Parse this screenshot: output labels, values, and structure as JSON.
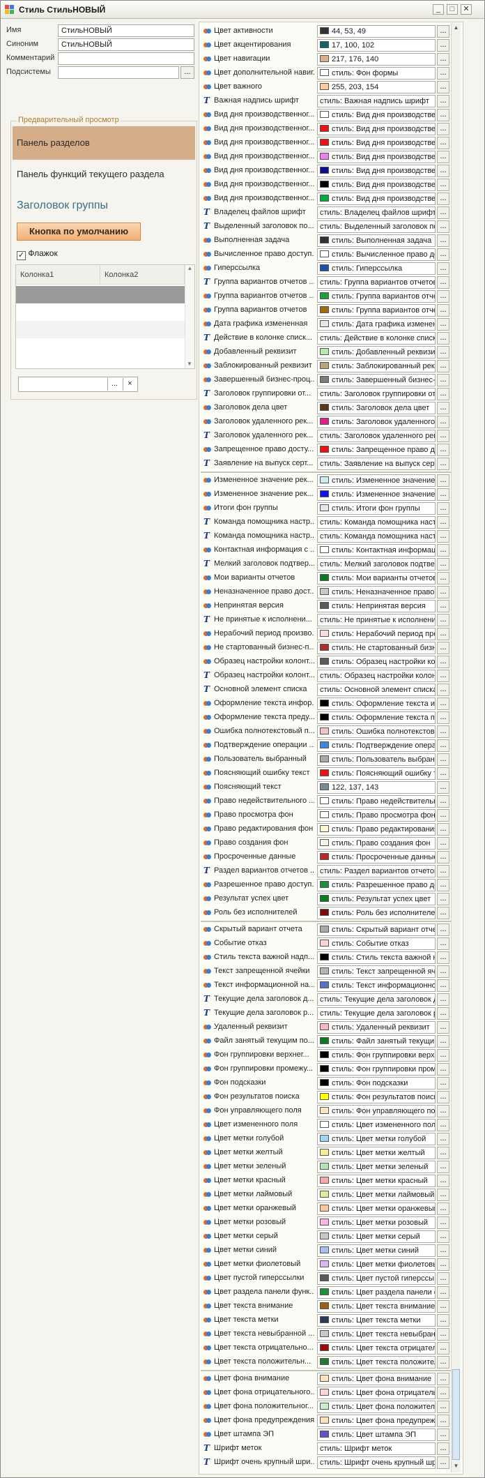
{
  "window": {
    "title": "Стиль СтильНОВЫЙ",
    "min": "_",
    "max": "□",
    "close": "✕"
  },
  "fields": {
    "name_label": "Имя",
    "name_value": "СтильНОВЫЙ",
    "synonym_label": "Синоним",
    "synonym_value": "СтильНОВЫЙ",
    "comment_label": "Комментарий",
    "comment_value": "",
    "subsystems_label": "Подсистемы",
    "subsystems_value": "",
    "browse_btn": "..."
  },
  "preview": {
    "legend": "Предварительный просмотр",
    "panel_sections": "Панель разделов",
    "panel_functions": "Панель функций текущего раздела",
    "group_title": "Заголовок группы",
    "default_button": "Кнопка по умолчанию",
    "flag_label": "Флажок",
    "flag_checked": true,
    "table_columns": [
      "Колонка1",
      "Колонка2"
    ],
    "combo_btn": "...",
    "combo_clear": "×"
  },
  "colors": {
    "accent_orange": "#f2b07a",
    "panel_bg": "#d5ad89",
    "selected_row": "#9a9a9a"
  },
  "style_rows": [
    {
      "name": "Цвет активности",
      "value": "44, 53, 49",
      "color": "#2c3531",
      "icon": "color-icon"
    },
    {
      "name": "Цвет акцентирования",
      "value": "17, 100, 102",
      "color": "#116466",
      "icon": "color-icon"
    },
    {
      "name": "Цвет навигации",
      "value": "217, 176, 140",
      "color": "#d9b08c",
      "icon": "color-icon"
    },
    {
      "name": "Цвет дополнительной навиг...",
      "value": "стиль: Фон формы",
      "color": "#ffffff",
      "icon": "color-icon"
    },
    {
      "name": "Цвет важного",
      "value": "255, 203, 154",
      "color": "#ffcb9a",
      "icon": "color-icon"
    },
    {
      "name": "Важная надпись шрифт",
      "value": "стиль: Важная надпись шрифт",
      "color": "",
      "icon": "font-icon"
    },
    {
      "name": "Вид дня производственног...",
      "value": "стиль: Вид дня производственн...",
      "color": "#ffffff",
      "icon": "color-icon"
    },
    {
      "name": "Вид дня производственног...",
      "value": "стиль: Вид дня производственн...",
      "color": "#e81515",
      "icon": "color-icon"
    },
    {
      "name": "Вид дня производственног...",
      "value": "стиль: Вид дня производственн...",
      "color": "#e81515",
      "icon": "color-icon"
    },
    {
      "name": "Вид дня производственног...",
      "value": "стиль: Вид дня производственн...",
      "color": "#ef7fe6",
      "icon": "color-icon"
    },
    {
      "name": "Вид дня производственног...",
      "value": "стиль: Вид дня производственн...",
      "color": "#0d0d8c",
      "icon": "color-icon"
    },
    {
      "name": "Вид дня производственног...",
      "value": "стиль: Вид дня производственн...",
      "color": "#000000",
      "icon": "color-icon"
    },
    {
      "name": "Вид дня производственног...",
      "value": "стиль: Вид дня производственн...",
      "color": "#00aa3c",
      "icon": "color-icon"
    },
    {
      "name": "Владелец файлов шрифт",
      "value": "стиль: Владелец файлов шрифт",
      "color": "",
      "icon": "font-icon"
    },
    {
      "name": "Выделенный заголовок по...",
      "value": "стиль: Выделенный заголовок по...",
      "color": "",
      "icon": "font-icon"
    },
    {
      "name": "Выполненная задача",
      "value": "стиль: Выполненная задача",
      "color": "#2c3531",
      "icon": "color-icon"
    },
    {
      "name": "Вычисленное право доступ...",
      "value": "стиль: Вычисленное право дос...",
      "color": "#ffffff",
      "icon": "color-icon"
    },
    {
      "name": "Гиперссылка",
      "value": "стиль: Гиперссылка",
      "color": "#1f4fa8",
      "icon": "color-icon"
    },
    {
      "name": "Группа вариантов отчетов ...",
      "value": "стиль: Группа вариантов отчетов ...",
      "color": "",
      "icon": "font-icon"
    },
    {
      "name": "Группа вариантов отчетов ...",
      "value": "стиль: Группа вариантов отче...",
      "color": "#1e9e3c",
      "icon": "color-icon"
    },
    {
      "name": "Группа вариантов отчетов",
      "value": "стиль: Группа вариантов отче...",
      "color": "#a36a12",
      "icon": "color-icon"
    },
    {
      "name": "Дата графика измененная",
      "value": "стиль: Дата графика изменен...",
      "color": "#e6e6e6",
      "icon": "color-icon"
    },
    {
      "name": "Действие в колонке списк...",
      "value": "стиль: Действие в колонке списк...",
      "color": "",
      "icon": "font-icon"
    },
    {
      "name": "Добавленный реквизит",
      "value": "стиль: Добавленный реквизит",
      "color": "#b7e8b0",
      "icon": "color-icon"
    },
    {
      "name": "Заблокированный реквизит",
      "value": "стиль: Заблокированный рекв...",
      "color": "#b5a67a",
      "icon": "color-icon"
    },
    {
      "name": "Завершенный бизнес-проц...",
      "value": "стиль: Завершенный бизнес-пр...",
      "color": "#7d7d7d",
      "icon": "color-icon"
    },
    {
      "name": "Заголовок группировки от...",
      "value": "стиль: Заголовок группировки от...",
      "color": "",
      "icon": "font-icon"
    },
    {
      "name": "Заголовок дела цвет",
      "value": "стиль: Заголовок дела цвет",
      "color": "#5a3b16",
      "icon": "color-icon"
    },
    {
      "name": "Заголовок удаленного рек...",
      "value": "стиль: Заголовок удаленного ...",
      "color": "#d8238a",
      "icon": "color-icon"
    },
    {
      "name": "Заголовок удаленного рек...",
      "value": "стиль: Заголовок удаленного рек...",
      "color": "",
      "icon": "font-icon"
    },
    {
      "name": "Запрещенное право досту...",
      "value": "стиль: Запрещенное право до...",
      "color": "#e81515",
      "icon": "color-icon"
    },
    {
      "name": "Заявление на выпуск серт...",
      "value": "стиль: Заявление на выпуск серт...",
      "color": "",
      "icon": "font-icon"
    },
    {
      "name": "Измененное значение рек...",
      "value": "стиль: Измененное значение ...",
      "color": "#cdeaf5",
      "icon": "color-icon"
    },
    {
      "name": "Измененное значение рек...",
      "value": "стиль: Измененное значение ...",
      "color": "#1414e0",
      "icon": "color-icon"
    },
    {
      "name": "Итоги фон группы",
      "value": "стиль: Итоги фон группы",
      "color": "#e6e6e6",
      "icon": "color-icon"
    },
    {
      "name": "Команда помощника настр...",
      "value": "стиль: Команда помощника настр...",
      "color": "",
      "icon": "font-icon"
    },
    {
      "name": "Команда помощника настр...",
      "value": "стиль: Команда помощника настр...",
      "color": "",
      "icon": "font-icon"
    },
    {
      "name": "Контактная информация с ...",
      "value": "стиль: Контактная информаци...",
      "color": "#ffffff",
      "icon": "color-icon"
    },
    {
      "name": "Мелкий заголовок подтвер...",
      "value": "стиль: Мелкий заголовок подтвер...",
      "color": "",
      "icon": "font-icon"
    },
    {
      "name": "Мои варианты отчетов",
      "value": "стиль: Мои варианты отчетов",
      "color": "#0b7a1e",
      "icon": "color-icon"
    },
    {
      "name": "Неназначенное право дост...",
      "value": "стиль: Неназначенное право д...",
      "color": "#c8c8c8",
      "icon": "color-icon"
    },
    {
      "name": "Непринятая версия",
      "value": "стиль: Непринятая версия",
      "color": "#5a5a5a",
      "icon": "color-icon"
    },
    {
      "name": "Не принятые к исполнени...",
      "value": "стиль: Не принятые к исполнени...",
      "color": "",
      "icon": "font-icon"
    },
    {
      "name": "Нерабочий период произво...",
      "value": "стиль: Нерабочий период прои...",
      "color": "#f7dede",
      "icon": "color-icon"
    },
    {
      "name": "Не стартованный бизнес-п...",
      "value": "стиль: Не стартованный бизне...",
      "color": "#b62a2a",
      "icon": "color-icon"
    },
    {
      "name": "Образец настройки колонт...",
      "value": "стиль: Образец настройки кол...",
      "color": "#5a5a5a",
      "icon": "color-icon"
    },
    {
      "name": "Образец настройки колонт...",
      "value": "стиль: Образец настройки колонт...",
      "color": "",
      "icon": "font-icon"
    },
    {
      "name": "Основной элемент списка",
      "value": "стиль: Основной элемент списка",
      "color": "",
      "icon": "font-icon"
    },
    {
      "name": "Оформление текста инфор...",
      "value": "стиль: Оформление текста ин...",
      "color": "#000000",
      "icon": "color-icon"
    },
    {
      "name": "Оформление текста преду...",
      "value": "стиль: Оформление текста пр...",
      "color": "#000000",
      "icon": "color-icon"
    },
    {
      "name": "Ошибка полнотекстовый п...",
      "value": "стиль: Ошибка полнотекстово...",
      "color": "#f4c3c3",
      "icon": "color-icon"
    },
    {
      "name": "Подтверждение операции ...",
      "value": "стиль: Подтверждение операц...",
      "color": "#3a8ad6",
      "icon": "color-icon"
    },
    {
      "name": "Пользователь выбранный",
      "value": "стиль: Пользователь выбранн...",
      "color": "#a9a9a9",
      "icon": "color-icon"
    },
    {
      "name": "Поясняющий ошибку текст",
      "value": "стиль: Поясняющий ошибку те...",
      "color": "#e81515",
      "icon": "color-icon"
    },
    {
      "name": "Поясняющий текст",
      "value": "122, 137, 143",
      "color": "#7a898f",
      "icon": "color-icon"
    },
    {
      "name": "Право недействительного ...",
      "value": "стиль: Право недействительн...",
      "color": "#ffffff",
      "icon": "color-icon"
    },
    {
      "name": "Право просмотра фон",
      "value": "стиль: Право просмотра фон",
      "color": "#ffffff",
      "icon": "color-icon"
    },
    {
      "name": "Право редактирования фон",
      "value": "стиль: Право редактирования ...",
      "color": "#fff6d5",
      "icon": "color-icon"
    },
    {
      "name": "Право создания фон",
      "value": "стиль: Право создания фон",
      "color": "#eef6e8",
      "icon": "color-icon"
    },
    {
      "name": "Просроченные данные",
      "value": "стиль: Просроченные данные",
      "color": "#b62a2a",
      "icon": "color-icon"
    },
    {
      "name": "Раздел вариантов отчетов ...",
      "value": "стиль: Раздел вариантов отчетов ...",
      "color": "",
      "icon": "font-icon"
    },
    {
      "name": "Разрешенное право доступ...",
      "value": "стиль: Разрешенное право до...",
      "color": "#1e8e3c",
      "icon": "color-icon"
    },
    {
      "name": "Результат успех цвет",
      "value": "стиль: Результат успех цвет",
      "color": "#0b7a1e",
      "icon": "color-icon"
    },
    {
      "name": "Роль без исполнителей",
      "value": "стиль: Роль без исполнителей",
      "color": "#7a0c0c",
      "icon": "color-icon"
    },
    {
      "name": "Скрытый вариант отчета",
      "value": "стиль: Скрытый вариант отчет...",
      "color": "#a9a9a9",
      "icon": "color-icon"
    },
    {
      "name": "Событие отказ",
      "value": "стиль: Событие отказ",
      "color": "#fad6d6",
      "icon": "color-icon"
    },
    {
      "name": "Стиль текста важной надп...",
      "value": "стиль: Стиль текста важной н...",
      "color": "#000000",
      "icon": "color-icon"
    },
    {
      "name": "Текст запрещенной ячейки",
      "value": "стиль: Текст запрещенной яче...",
      "color": "#b4b4b4",
      "icon": "color-icon"
    },
    {
      "name": "Текст информационной на...",
      "value": "стиль: Текст информационно...",
      "color": "#5a6fc8",
      "icon": "color-icon"
    },
    {
      "name": "Текущие дела заголовок д...",
      "value": "стиль: Текущие дела заголовок д...",
      "color": "",
      "icon": "font-icon"
    },
    {
      "name": "Текущие дела заголовок р...",
      "value": "стиль: Текущие дела заголовок р...",
      "color": "",
      "icon": "font-icon"
    },
    {
      "name": "Удаленный реквизит",
      "value": "стиль: Удаленный реквизит",
      "color": "#f4b8b8",
      "icon": "color-icon"
    },
    {
      "name": "Файл занятый текущим по...",
      "value": "стиль: Файл занятый текущи...",
      "color": "#0b7a1e",
      "icon": "color-icon"
    },
    {
      "name": "Фон группировки верхнег...",
      "value": "стиль: Фон группировки верх...",
      "color": "#000000",
      "icon": "color-icon"
    },
    {
      "name": "Фон группировки промежу...",
      "value": "стиль: Фон группировки пром...",
      "color": "#000000",
      "icon": "color-icon"
    },
    {
      "name": "Фон подсказки",
      "value": "стиль: Фон подсказки",
      "color": "#000000",
      "icon": "color-icon"
    },
    {
      "name": "Фон результатов поиска",
      "value": "стиль: Фон результатов поиск...",
      "color": "#ffff00",
      "icon": "color-icon"
    },
    {
      "name": "Фон управляющего поля",
      "value": "стиль: Фон управляющего по...",
      "color": "#fbe3c8",
      "icon": "color-icon"
    },
    {
      "name": "Цвет измененного поля",
      "value": "стиль: Цвет измененного пол...",
      "color": "#ffffff",
      "icon": "color-icon"
    },
    {
      "name": "Цвет метки голубой",
      "value": "стиль: Цвет метки голубой",
      "color": "#9fd5f0",
      "icon": "color-icon"
    },
    {
      "name": "Цвет метки желтый",
      "value": "стиль: Цвет метки желтый",
      "color": "#f3ef96",
      "icon": "color-icon"
    },
    {
      "name": "Цвет метки зеленый",
      "value": "стиль: Цвет метки зеленый",
      "color": "#b6e3b6",
      "icon": "color-icon"
    },
    {
      "name": "Цвет метки красный",
      "value": "стиль: Цвет метки красный",
      "color": "#f4aaaa",
      "icon": "color-icon"
    },
    {
      "name": "Цвет метки лаймовый",
      "value": "стиль: Цвет метки лаймовый",
      "color": "#d6ef9e",
      "icon": "color-icon"
    },
    {
      "name": "Цвет метки оранжевый",
      "value": "стиль: Цвет метки оранжевый",
      "color": "#f8c89a",
      "icon": "color-icon"
    },
    {
      "name": "Цвет метки розовый",
      "value": "стиль: Цвет метки розовый",
      "color": "#f7b7df",
      "icon": "color-icon"
    },
    {
      "name": "Цвет метки серый",
      "value": "стиль: Цвет метки серый",
      "color": "#c8c8c8",
      "icon": "color-icon"
    },
    {
      "name": "Цвет метки синий",
      "value": "стиль: Цвет метки синий",
      "color": "#a8bff0",
      "icon": "color-icon"
    },
    {
      "name": "Цвет метки фиолетовый",
      "value": "стиль: Цвет метки фиолетовый",
      "color": "#d8b8ef",
      "icon": "color-icon"
    },
    {
      "name": "Цвет пустой гиперссылки",
      "value": "стиль: Цвет пустой гиперссы...",
      "color": "#5a5a5a",
      "icon": "color-icon"
    },
    {
      "name": "Цвет раздела панели функ...",
      "value": "стиль: Цвет раздела панели ф...",
      "color": "#1e8e3c",
      "icon": "color-icon"
    },
    {
      "name": "Цвет текста внимание",
      "value": "стиль: Цвет текста внимание",
      "color": "#a35a12",
      "icon": "color-icon"
    },
    {
      "name": "Цвет текста метки",
      "value": "стиль: Цвет текста метки",
      "color": "#2c3a55",
      "icon": "color-icon"
    },
    {
      "name": "Цвет текста невыбранной ...",
      "value": "стиль: Цвет текста невыбран...",
      "color": "#c8c8c8",
      "icon": "color-icon"
    },
    {
      "name": "Цвет текста отрицательно...",
      "value": "стиль: Цвет текста отрицател...",
      "color": "#9a0c0c",
      "icon": "color-icon"
    },
    {
      "name": "Цвет текста положительн...",
      "value": "стиль: Цвет текста положител...",
      "color": "#1e7a2e",
      "icon": "color-icon"
    },
    {
      "name": "Цвет фона внимание",
      "value": "стиль: Цвет фона внимание",
      "color": "#fde4b8",
      "icon": "color-icon"
    },
    {
      "name": "Цвет фона отрицательного...",
      "value": "стиль: Цвет фона отрицатель...",
      "color": "#fad6d6",
      "icon": "color-icon"
    },
    {
      "name": "Цвет фона положительног...",
      "value": "стиль: Цвет фона положитель...",
      "color": "#c9ecc9",
      "icon": "color-icon"
    },
    {
      "name": "Цвет фона предупреждения",
      "value": "стиль: Цвет фона предупрежд...",
      "color": "#fde4b8",
      "icon": "color-icon"
    },
    {
      "name": "Цвет штампа ЭП",
      "value": "стиль: Цвет штампа ЭП",
      "color": "#6a4fc8",
      "icon": "color-icon"
    },
    {
      "name": "Шрифт меток",
      "value": "стиль: Шрифт меток",
      "color": "",
      "icon": "font-icon"
    },
    {
      "name": "Шрифт очень крупный шри...",
      "value": "стиль: Шрифт очень крупный шри...",
      "color": "",
      "icon": "font-icon"
    }
  ],
  "row_button": "...",
  "scroll_up": "▲",
  "scroll_down": "▼"
}
